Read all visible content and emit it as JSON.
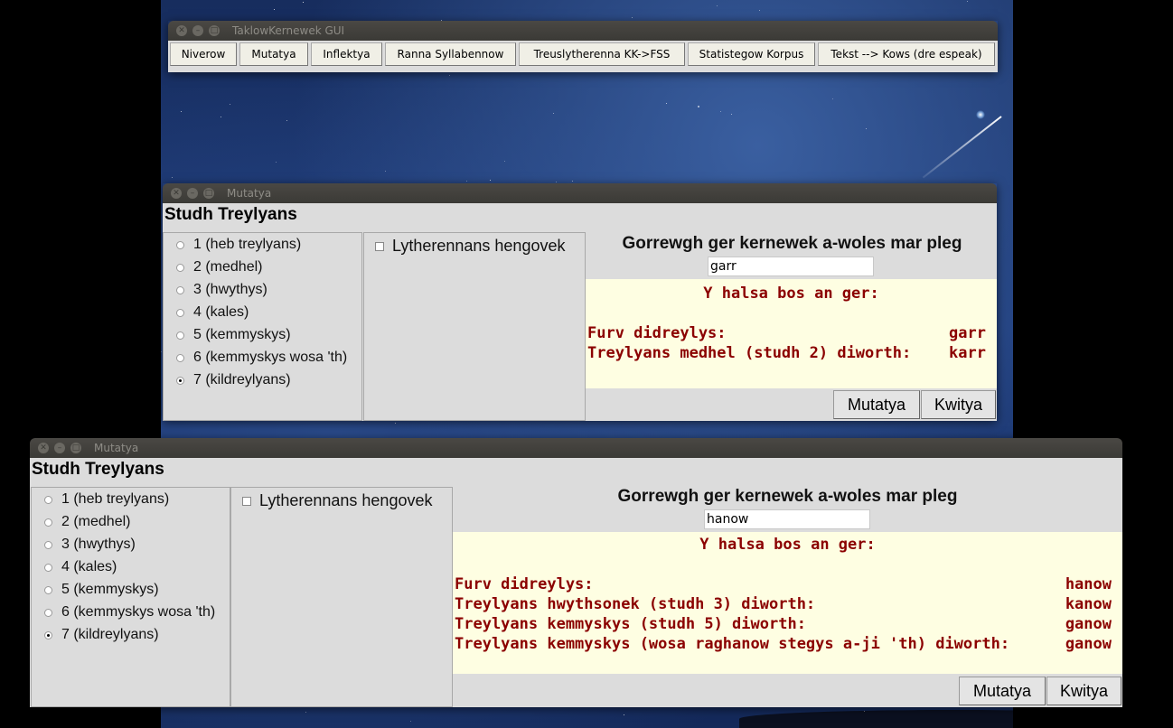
{
  "main_window": {
    "title": "TaklowKernewek GUI",
    "menu_buttons": [
      "Niverow",
      "Mutatya",
      "Inflektya",
      "Ranna Syllabennow",
      "Treuslytherenna KK->FSS",
      "Statistegow Korpus",
      "Tekst --> Kows (dre espeak)"
    ]
  },
  "mutatya_windows": [
    {
      "title": "Mutatya",
      "studh_title": "Studh Treylyans",
      "radios": [
        {
          "label": "1 (heb treylyans)",
          "selected": false
        },
        {
          "label": "2 (medhel)",
          "selected": false
        },
        {
          "label": "3 (hwythys)",
          "selected": false
        },
        {
          "label": "4 (kales)",
          "selected": false
        },
        {
          "label": "5 (kemmyskys)",
          "selected": false
        },
        {
          "label": "6 (kemmyskys wosa 'th)",
          "selected": false
        },
        {
          "label": "7 (kildreylyans)",
          "selected": true
        }
      ],
      "checkbox_label": "Lytherennans hengovek",
      "checkbox_checked": false,
      "prompt": "Gorrewgh ger kernewek a-woles mar pleg",
      "input_value": "garr",
      "result_heading": "Y halsa bos an ger:",
      "results": [
        {
          "label": "Furv didreylys:",
          "value": "garr"
        },
        {
          "label": "Treylyans medhel (studh 2) diworth:",
          "value": "karr"
        }
      ],
      "mutatya_button": "Mutatya",
      "kwitya_button": "Kwitya"
    },
    {
      "title": "Mutatya",
      "studh_title": "Studh Treylyans",
      "radios": [
        {
          "label": "1 (heb treylyans)",
          "selected": false
        },
        {
          "label": "2 (medhel)",
          "selected": false
        },
        {
          "label": "3 (hwythys)",
          "selected": false
        },
        {
          "label": "4 (kales)",
          "selected": false
        },
        {
          "label": "5 (kemmyskys)",
          "selected": false
        },
        {
          "label": "6 (kemmyskys wosa 'th)",
          "selected": false
        },
        {
          "label": "7 (kildreylyans)",
          "selected": true
        }
      ],
      "checkbox_label": "Lytherennans hengovek",
      "checkbox_checked": false,
      "prompt": "Gorrewgh ger kernewek a-woles mar pleg",
      "input_value": "hanow",
      "result_heading": "Y halsa bos an ger:",
      "results": [
        {
          "label": "Furv didreylys:",
          "value": "hanow"
        },
        {
          "label": "Treylyans hwythsonek (studh 3) diworth:",
          "value": "kanow"
        },
        {
          "label": "Treylyans kemmyskys (studh 5) diworth:",
          "value": "ganow"
        },
        {
          "label": "Treylyans kemmyskys (wosa raghanow stegys a-ji 'th) diworth:",
          "value": "ganow"
        }
      ],
      "mutatya_button": "Mutatya",
      "kwitya_button": "Kwitya"
    }
  ],
  "colors": {
    "result_text": "#8b0000",
    "result_bg": "#fefee2",
    "window_bg": "#dcdcdc",
    "titlebar": "#3b3a36"
  }
}
